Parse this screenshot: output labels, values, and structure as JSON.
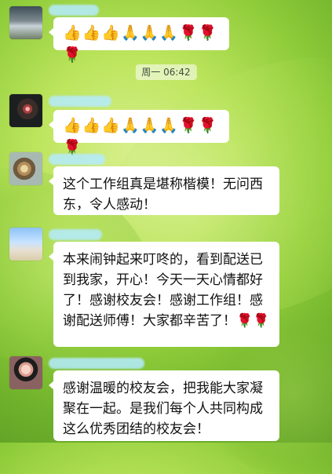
{
  "chat": {
    "timestamp": "周一 06:42",
    "messages": [
      {
        "emoji_text": "👍👍👍🙏🙏🙏🌹🌹🌹"
      },
      {
        "emoji_text": "👍👍👍🙏🙏🙏🌹🌹🌹"
      },
      {
        "text": "这个工作组真是堪称楷模！无问西东，令人感动！"
      },
      {
        "text": "本来闹钟起来叮咚的，看到配送已到我家，开心！今天一天心情都好了！感谢校友会！感谢工作组！感谢配送师傅！大家都辛苦了！🌹🌹"
      },
      {
        "text": "感谢温暖的校友会，把我能大家凝聚在一起。是我们每个人共同构成这么优秀团结的校友会！"
      }
    ]
  }
}
